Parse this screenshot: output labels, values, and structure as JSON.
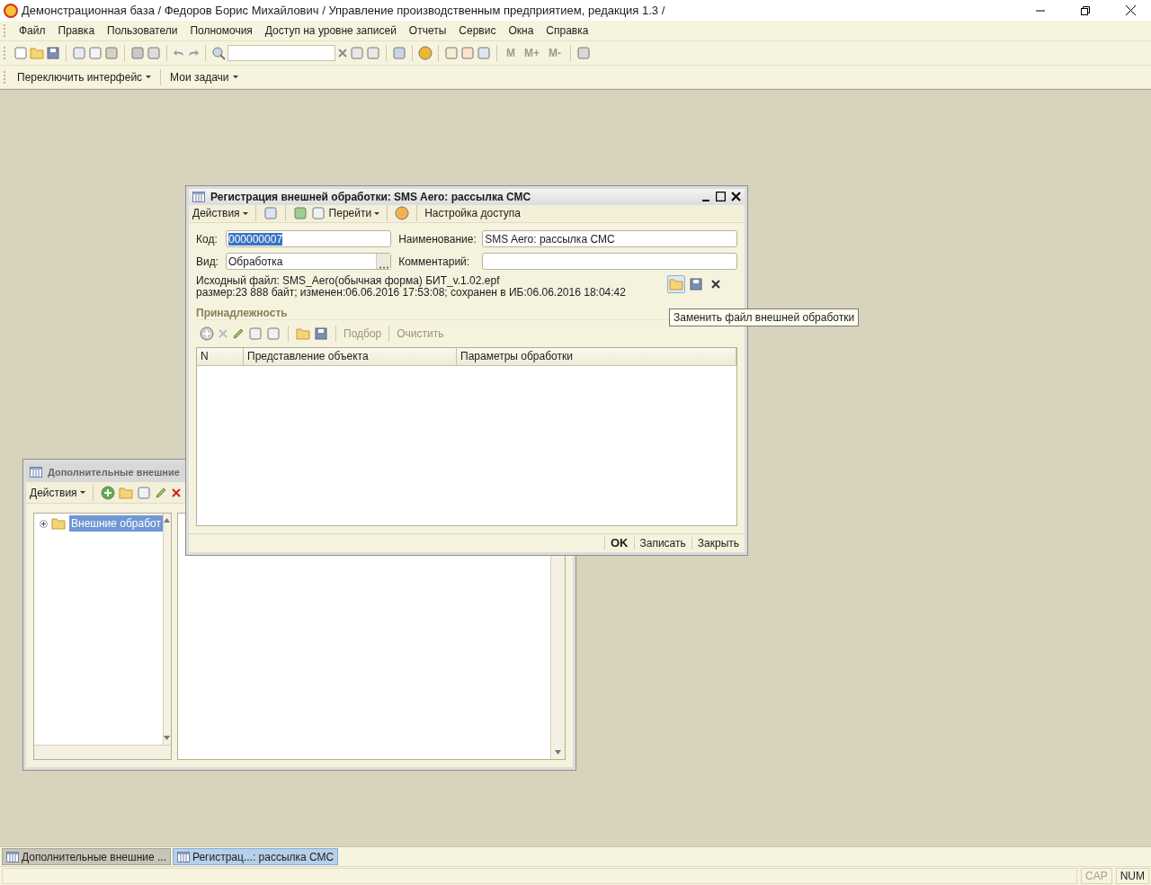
{
  "app_title": "Демонстрационная база / Федоров Борис Михайлович /  Управление производственным предприятием, редакция 1.3 /",
  "menu": [
    {
      "label": "Файл"
    },
    {
      "label": "Правка"
    },
    {
      "label": "Пользователи"
    },
    {
      "label": "Полномочия"
    },
    {
      "label": "Доступ на уровне записей"
    },
    {
      "label": "Отчеты"
    },
    {
      "label": "Сервис"
    },
    {
      "label": "Окна"
    },
    {
      "label": "Справка"
    }
  ],
  "memory_buttons": [
    "M",
    "M+",
    "M-"
  ],
  "panel_toolbar": [
    {
      "label": "Переключить интерфейс"
    },
    {
      "label": "Мои задачи"
    }
  ],
  "back_window": {
    "title": "Дополнительные внешние",
    "actions": "Действия",
    "tree": [
      {
        "label": "Внешние обработ",
        "selected": true,
        "expanded": false
      }
    ]
  },
  "dialog": {
    "title": "Регистрация внешней обработки: SMS Aero:  рассылка СМС",
    "toolbar": {
      "actions": "Действия",
      "goto": "Перейти",
      "access": "Настройка доступа"
    },
    "code": {
      "label": "Код:",
      "value": "000000007",
      "text_selected": true
    },
    "name": {
      "label": "Наименование:",
      "value": "SMS Aero:  рассылка СМС"
    },
    "kind": {
      "label": "Вид:",
      "value": "Обработка"
    },
    "comment": {
      "label": "Комментарий:"
    },
    "file_info": [
      "Исходный файл: SMS_Aero(обычная форма) БИТ_v.1.02.epf",
      "размер:23 888 байт; изменен:06.06.2016 17:53:08; сохранен в ИБ:06.06.2016 18:04:42"
    ],
    "section": "Принадлежность",
    "table_buttons": [
      "Подбор",
      "Очистить"
    ],
    "columns": [
      "N",
      "Представление объекта",
      "Параметры обработки"
    ],
    "buttons": [
      "OK",
      "Записать",
      "Закрыть"
    ],
    "tooltip": "Заменить файл внешней обработки"
  },
  "taskbar": [
    {
      "label": "Дополнительные внешние ...",
      "selected": false
    },
    {
      "label": "Регистрац...:  рассылка СМС",
      "selected": true
    }
  ],
  "status": [
    {
      "label": "CAP",
      "active": false
    },
    {
      "label": "NUM",
      "active": true
    }
  ]
}
